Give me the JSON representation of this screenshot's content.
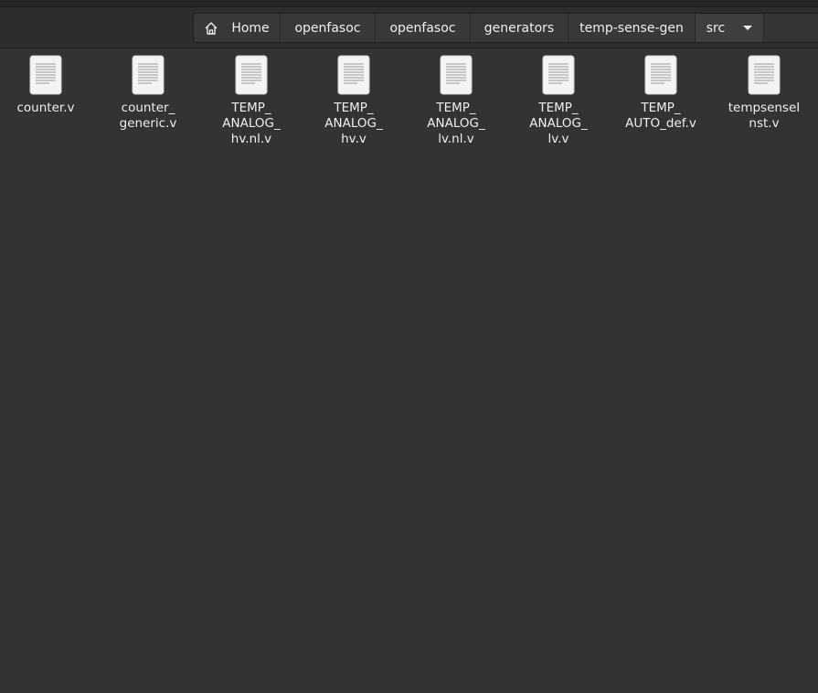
{
  "breadcrumb": {
    "items": [
      {
        "label": "Home",
        "icon": "home-icon"
      },
      {
        "label": "openfasoc"
      },
      {
        "label": "openfasoc"
      },
      {
        "label": "generators"
      },
      {
        "label": "temp-sense-gen"
      },
      {
        "label": "src",
        "has_dropdown": true
      }
    ]
  },
  "files": [
    {
      "label": "counter.v",
      "icon": "text-file-icon"
    },
    {
      "label": "counter_\ngeneric.v",
      "icon": "text-file-icon"
    },
    {
      "label": "TEMP_\nANALOG_\nhv.nl.v",
      "icon": "text-file-icon"
    },
    {
      "label": "TEMP_\nANALOG_\nhv.v",
      "icon": "text-file-icon"
    },
    {
      "label": "TEMP_\nANALOG_\nlv.nl.v",
      "icon": "text-file-icon"
    },
    {
      "label": "TEMP_\nANALOG_\nlv.v",
      "icon": "text-file-icon"
    },
    {
      "label": "TEMP_\nAUTO_def.v",
      "icon": "text-file-icon"
    },
    {
      "label": "tempsenseI\nnst.v",
      "icon": "text-file-icon"
    }
  ],
  "colors": {
    "background": "#333333",
    "header": "#2d2d2d",
    "text": "#eeeeee"
  }
}
